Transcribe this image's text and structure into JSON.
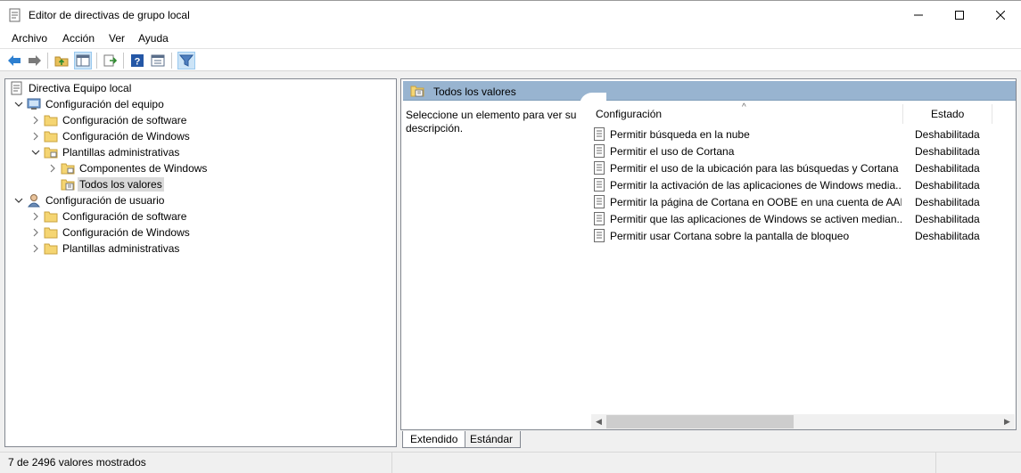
{
  "window": {
    "title": "Editor de directivas de grupo local"
  },
  "menu": [
    "Archivo",
    "Acción",
    "Ver",
    "Ayuda"
  ],
  "toolbar": {
    "icons": [
      "back-arrow-icon",
      "forward-arrow-icon",
      "up-folder-icon",
      "show-hide-tree-icon",
      "export-list-icon",
      "help-icon",
      "properties-icon",
      "filter-icon"
    ],
    "active": "filter-icon"
  },
  "tree": [
    {
      "label": "Directiva Equipo local",
      "level": 0,
      "expander": "none",
      "icon": "policy-document-icon"
    },
    {
      "label": "Configuración del equipo",
      "level": 1,
      "expander": "expanded",
      "icon": "computer-icon"
    },
    {
      "label": "Configuración de software",
      "level": 2,
      "expander": "collapsed",
      "icon": "folder-icon"
    },
    {
      "label": "Configuración de Windows",
      "level": 2,
      "expander": "collapsed",
      "icon": "folder-icon"
    },
    {
      "label": "Plantillas administrativas",
      "level": 2,
      "expander": "expanded",
      "icon": "folder-icon"
    },
    {
      "label": "Componentes de Windows",
      "level": 3,
      "expander": "collapsed",
      "icon": "folder-icon"
    },
    {
      "label": "Todos los valores",
      "level": 3,
      "expander": "none",
      "icon": "all-settings-icon",
      "selected": true
    },
    {
      "label": "Configuración de usuario",
      "level": 1,
      "expander": "expanded",
      "icon": "user-icon"
    },
    {
      "label": "Configuración de software",
      "level": 2,
      "expander": "collapsed",
      "icon": "folder-icon"
    },
    {
      "label": "Configuración de Windows",
      "level": 2,
      "expander": "collapsed",
      "icon": "folder-icon"
    },
    {
      "label": "Plantillas administrativas",
      "level": 2,
      "expander": "collapsed",
      "icon": "folder-icon"
    }
  ],
  "right": {
    "header": "Todos los valores",
    "description": "Seleccione un elemento para ver su descripción.",
    "columns": {
      "setting": "Configuración",
      "state": "Estado"
    },
    "rows": [
      {
        "name": "Permitir búsqueda en la nube",
        "state": "Deshabilitada"
      },
      {
        "name": "Permitir el uso de Cortana",
        "state": "Deshabilitada"
      },
      {
        "name": "Permitir el uso de la ubicación para las búsquedas y Cortana",
        "state": "Deshabilitada"
      },
      {
        "name": "Permitir la activación de las aplicaciones de Windows media...",
        "state": "Deshabilitada"
      },
      {
        "name": "Permitir la página de Cortana en OOBE en una cuenta de AAD",
        "state": "Deshabilitada"
      },
      {
        "name": "Permitir que las aplicaciones de Windows se activen median...",
        "state": "Deshabilitada"
      },
      {
        "name": "Permitir usar Cortana sobre la pantalla de bloqueo",
        "state": "Deshabilitada"
      }
    ]
  },
  "tabs": [
    "Extendido",
    "Estándar"
  ],
  "status": "7 de 2496 valores mostrados",
  "colors": {
    "header_bg": "#98b4d0",
    "selection": "#d9d9d9",
    "filter_active": "#cce4f7"
  }
}
